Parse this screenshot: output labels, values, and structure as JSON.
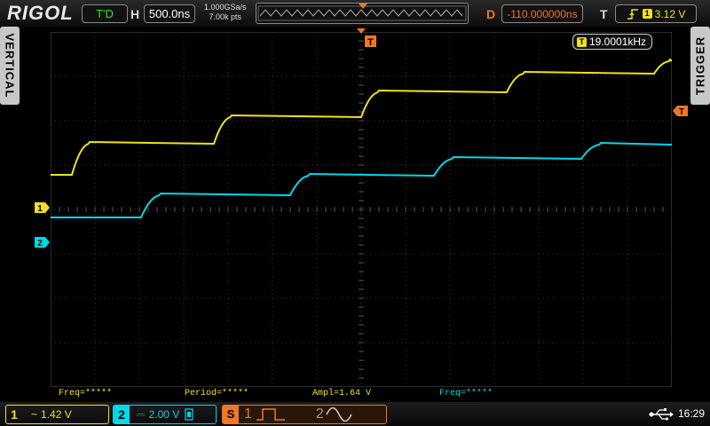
{
  "header": {
    "logo": "RIGOL",
    "run_status": "T'D",
    "horizontal_label": "H",
    "timebase": "500.0ns",
    "sample_rate": "1.000GSa/s",
    "memory_depth": "7.00k pts",
    "delay_label": "D",
    "delay": "-110.000000ns",
    "trigger_label": "T",
    "trigger_source": "1",
    "trigger_level": "3.12 V"
  },
  "side_tabs": {
    "left": "VERTICAL",
    "right": "TRIGGER"
  },
  "frequency_counter": {
    "badge": "T",
    "value": "19.0001kHz"
  },
  "markers": {
    "ch1": "1",
    "ch2": "2",
    "trigger_pos": "T",
    "trigger_level": "T"
  },
  "measurements": [
    {
      "text": "Freq=*****",
      "color": "#f0e020"
    },
    {
      "text": "Period=*****",
      "color": "#f0e020"
    },
    {
      "text": "Ampl=1.64 V",
      "color": "#f0e020"
    },
    {
      "text": "Freq=*****",
      "color": "#00d8e8"
    }
  ],
  "channels": {
    "ch1": {
      "number": "1",
      "coupling": "~",
      "scale": "1.42 V",
      "color": "#f0e020"
    },
    "ch2": {
      "number": "2",
      "coupling": "⎓",
      "scale": "2.00 V",
      "color": "#00d8e8"
    }
  },
  "source_panel": {
    "label": "S",
    "src1": "1",
    "src2": "2"
  },
  "status_bar": {
    "time": "16:29"
  },
  "colors": {
    "ch1": "#f0e020",
    "ch2": "#00d8e8",
    "accent": "#f07820",
    "grid": "#3a3a3a"
  }
}
